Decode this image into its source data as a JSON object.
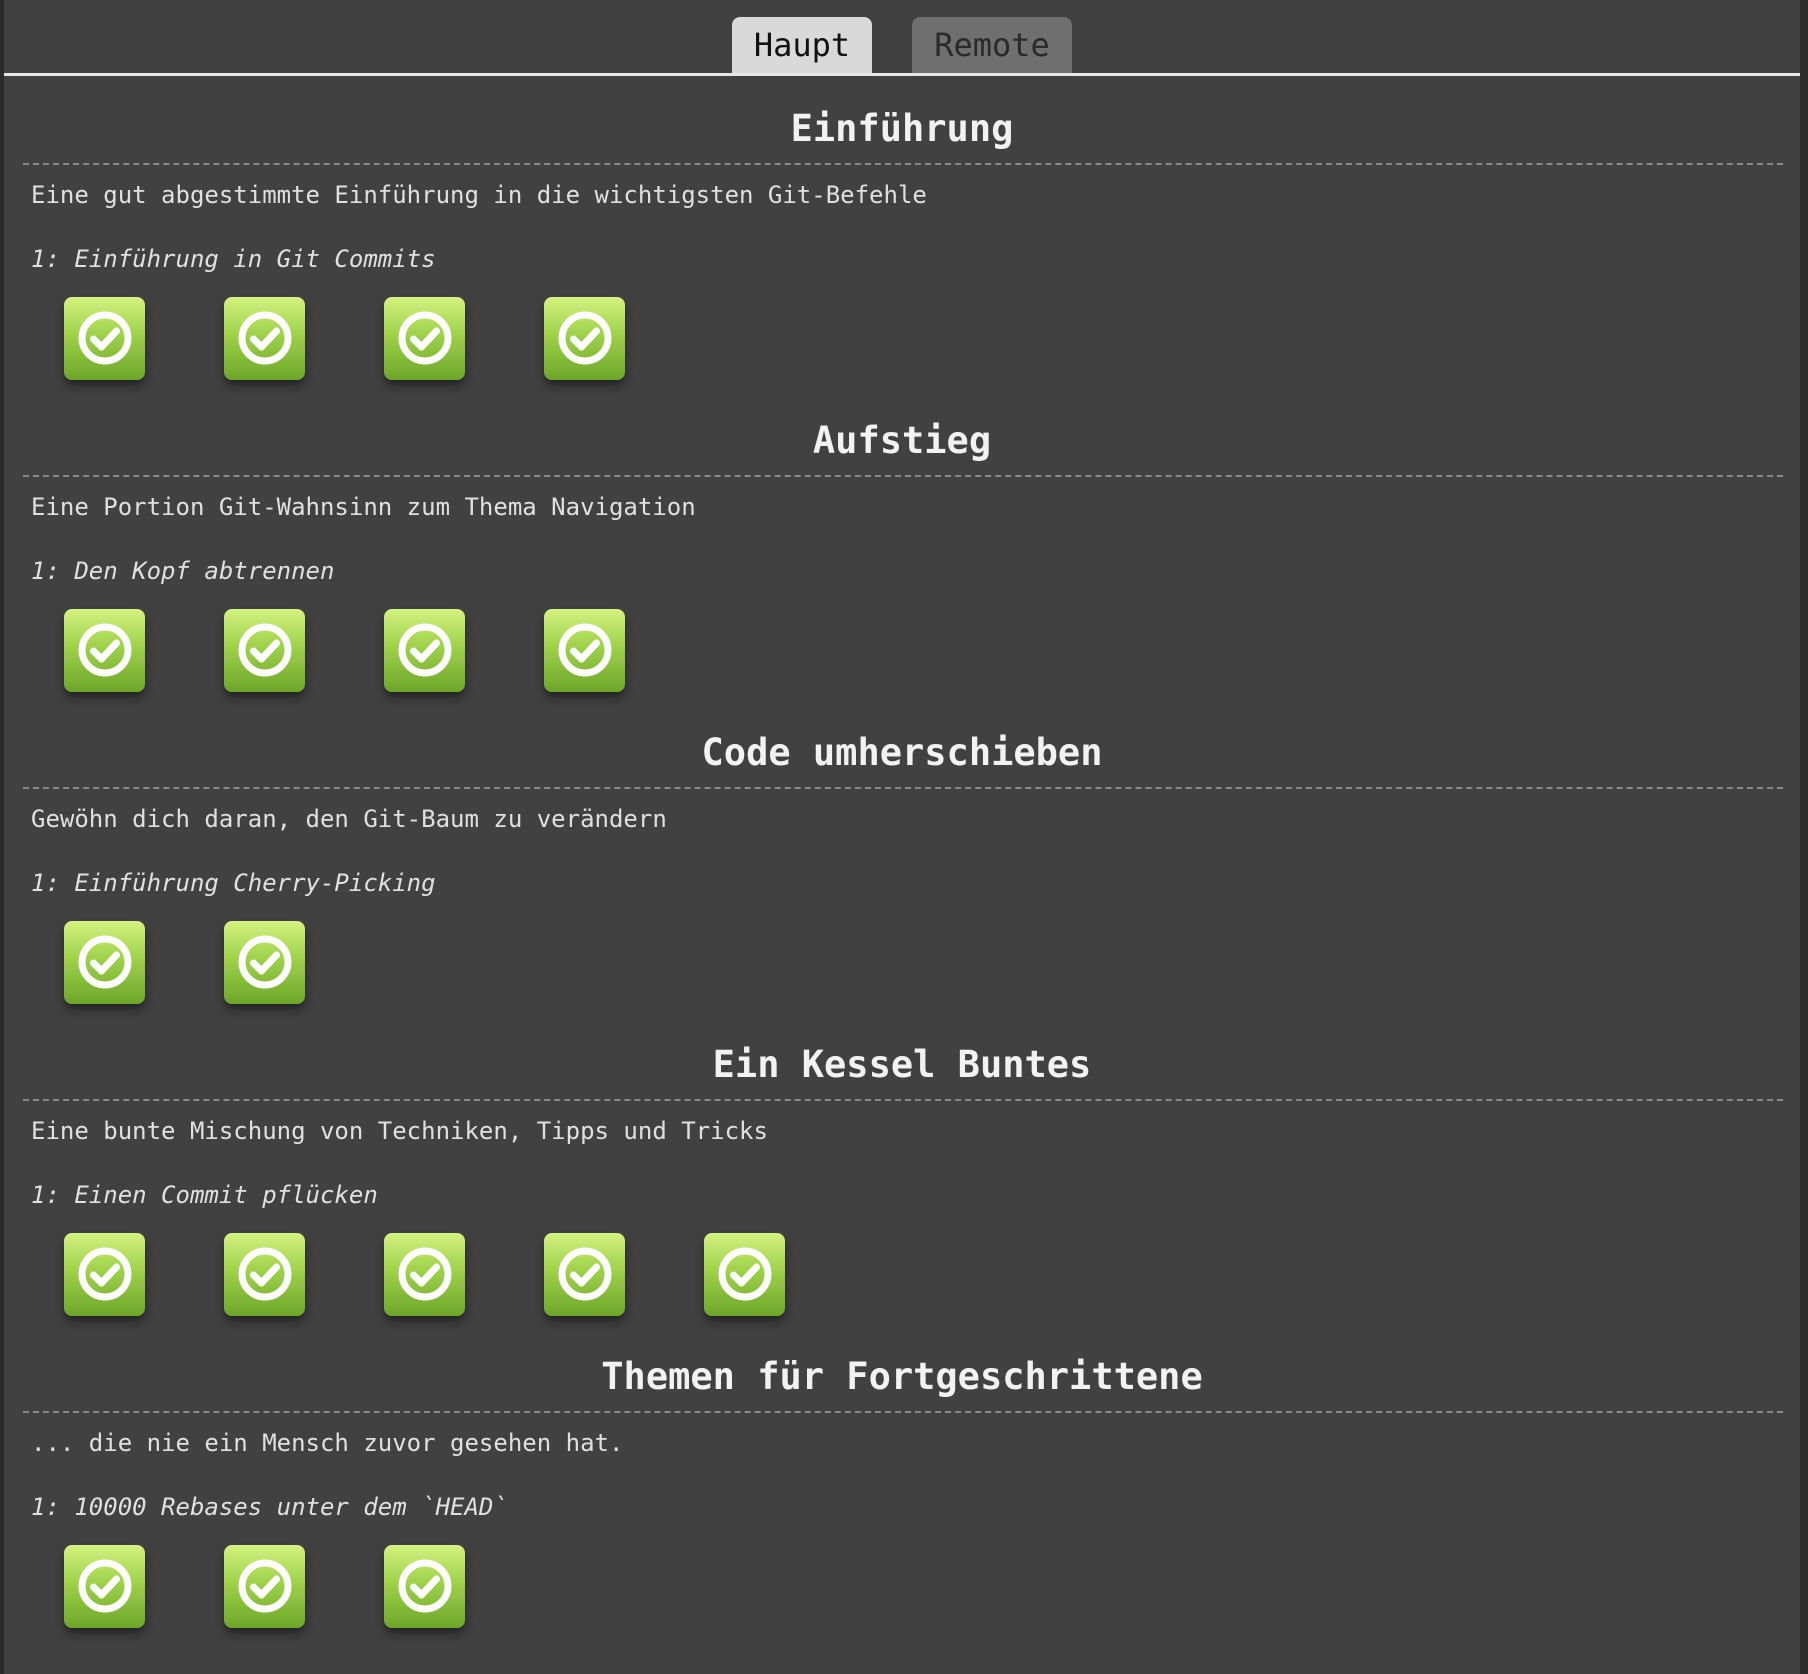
{
  "tabs": [
    {
      "label": "Haupt",
      "active": true
    },
    {
      "label": "Remote",
      "active": false
    }
  ],
  "sections": [
    {
      "title": "Einführung",
      "description": "Eine gut abgestimmte Einführung in die wichtigsten Git-Befehle",
      "level_label": "1: Einführung in Git Commits",
      "levels": [
        {
          "icon": "checkmark-circle-icon",
          "completed": true
        },
        {
          "icon": "checkmark-circle-icon",
          "completed": true
        },
        {
          "icon": "checkmark-circle-icon",
          "completed": true
        },
        {
          "icon": "checkmark-circle-icon",
          "completed": true
        }
      ]
    },
    {
      "title": "Aufstieg",
      "description": "Eine Portion Git-Wahnsinn zum Thema Navigation",
      "level_label": "1: Den Kopf abtrennen",
      "levels": [
        {
          "icon": "checkmark-circle-icon",
          "completed": true
        },
        {
          "icon": "checkmark-circle-icon",
          "completed": true
        },
        {
          "icon": "checkmark-circle-icon",
          "completed": true
        },
        {
          "icon": "checkmark-circle-icon",
          "completed": true
        }
      ]
    },
    {
      "title": "Code umherschieben",
      "description": "Gewöhn dich daran, den Git-Baum zu verändern",
      "level_label": "1: Einführung Cherry-Picking",
      "levels": [
        {
          "icon": "checkmark-circle-icon",
          "completed": true
        },
        {
          "icon": "checkmark-circle-icon",
          "completed": true
        }
      ]
    },
    {
      "title": "Ein Kessel Buntes",
      "description": "Eine bunte Mischung von Techniken, Tipps und Tricks",
      "level_label": "1: Einen Commit pflücken",
      "levels": [
        {
          "icon": "checkmark-circle-icon",
          "completed": true
        },
        {
          "icon": "checkmark-circle-icon",
          "completed": true
        },
        {
          "icon": "checkmark-circle-icon",
          "completed": true
        },
        {
          "icon": "checkmark-circle-icon",
          "completed": true
        },
        {
          "icon": "checkmark-circle-icon",
          "completed": true
        }
      ]
    },
    {
      "title": "Themen für Fortgeschrittene",
      "description": "... die nie ein Mensch zuvor gesehen hat.",
      "level_label": "1: 10000 Rebases unter dem `HEAD`",
      "levels": [
        {
          "icon": "checkmark-circle-icon",
          "completed": true
        },
        {
          "icon": "checkmark-circle-icon",
          "completed": true
        },
        {
          "icon": "checkmark-circle-icon",
          "completed": true
        }
      ]
    }
  ],
  "colors": {
    "background": "#414141",
    "text": "#e0e0e0",
    "completed_level": "#8fc63e"
  }
}
